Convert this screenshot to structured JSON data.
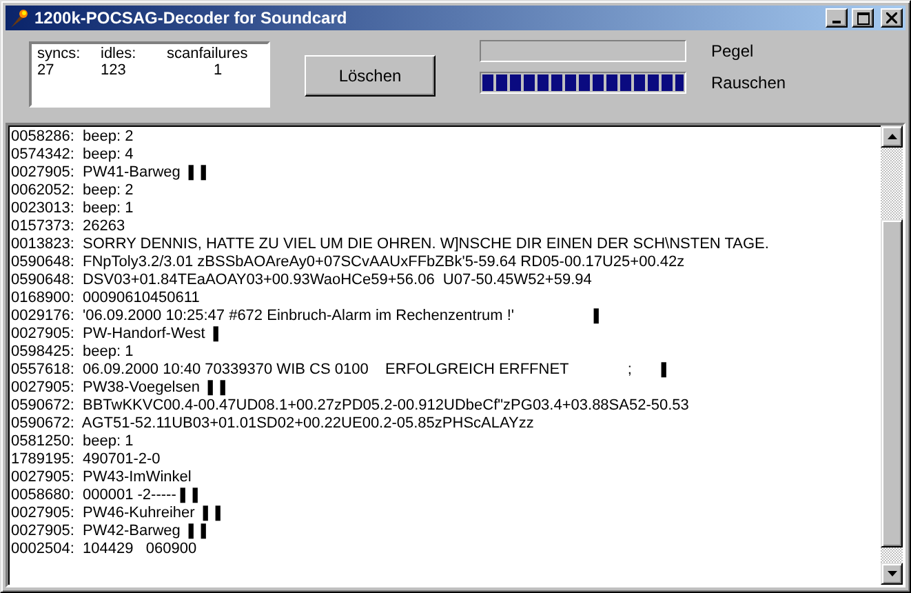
{
  "window": {
    "title": "1200k-POCSAG-Decoder for Soundcard"
  },
  "stats": {
    "headers": [
      "syncs:",
      "idles:",
      "scanfailures"
    ],
    "values": [
      "27",
      "123",
      "1"
    ]
  },
  "clear_button": "Löschen",
  "meters": [
    {
      "label": "Pegel"
    },
    {
      "label": "Rauschen",
      "level": 1
    }
  ],
  "log": [
    "0058286:  beep: 2",
    "0574342:  beep: 4",
    "0027905:  PW41-Barweg ❚❚",
    "0062052:  beep: 2",
    "0023013:  beep: 1",
    "0157373:  26263",
    "0013823:  SORRY DENNIS, HATTE ZU VIEL UM DIE OHREN. W]NSCHE DIR EINEN DER SCH\\NSTEN TAGE.",
    "0590648:  FNpToly3.2/3.01 zBSSbAOAreAy0+07SCvAAUxFFbZBk'5-59.64 RD05-00.17U25+00.42z",
    "0590648:  DSV03+01.84TEaAOAY03+00.93WaoHCe59+56.06  U07-50.45W52+59.94",
    "0168900:  00090610450611",
    "0029176:  '06.09.2000 10:25:47 #672 Einbruch-Alarm im Rechenzentrum !'                  ❚",
    "0027905:  PW-Handorf-West ❚",
    "0598425:  beep: 1",
    "0557618:  06.09.2000 10:40 70339370 WIB CS 0100    ERFOLGREICH ERFFNET              ;      ❚",
    "0027905:  PW38-Voegelsen ❚❚",
    "0590672:  BBTwKKVC00.4-00.47UD08.1+00.27zPD05.2-00.912UDbeCf\"zPG03.4+03.88SA52-50.53",
    "0590672:  AGT51-52.11UB03+01.01SD02+00.22UE00.2-05.85zPHScALAYzz",
    "0581250:  beep: 1",
    "1789195:  490701-2-0",
    "0027905:  PW43-ImWinkel",
    "0058680:  000001 -2-----❚❚",
    "0027905:  PW46-Kuhreiher ❚❚",
    "0027905:  PW42-Barweg ❚❚",
    "0002504:  104429   060900"
  ]
}
